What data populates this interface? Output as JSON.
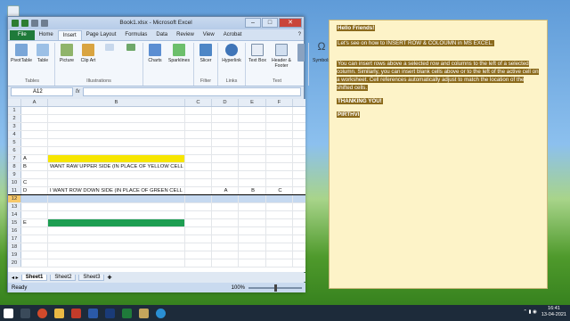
{
  "window": {
    "title": "Book1.xlsx - Microsoft Excel",
    "min": "–",
    "max": "□",
    "close": "✕"
  },
  "tabs": [
    "File",
    "Home",
    "Insert",
    "Page Layout",
    "Formulas",
    "Data",
    "Review",
    "View",
    "Acrobat"
  ],
  "ribbon": {
    "groups": [
      {
        "label": "Tables",
        "buttons": [
          "PivotTable",
          "Table"
        ]
      },
      {
        "label": "Illustrations",
        "buttons": [
          "Picture",
          "Clip Art",
          "",
          ""
        ]
      },
      {
        "label": "",
        "buttons": [
          "Charts",
          "Sparklines"
        ]
      },
      {
        "label": "Filter",
        "buttons": [
          "Slicer"
        ]
      },
      {
        "label": "Links",
        "buttons": [
          "Hyperlink"
        ]
      },
      {
        "label": "Text",
        "buttons": [
          "Text Box",
          "Header & Footer",
          ""
        ]
      },
      {
        "label": "",
        "buttons": [
          "Symbols"
        ]
      }
    ]
  },
  "formula_bar": {
    "name_box": "A12",
    "fx": "fx",
    "value": ""
  },
  "columns": [
    "",
    "A",
    "B",
    "C",
    "D",
    "E",
    "F"
  ],
  "rows": [
    {
      "n": "1",
      "A": "",
      "B": "",
      "D": "",
      "E": "",
      "F": ""
    },
    {
      "n": "2",
      "A": "",
      "B": "",
      "D": "",
      "E": "",
      "F": ""
    },
    {
      "n": "3",
      "A": "",
      "B": "",
      "D": "",
      "E": "",
      "F": ""
    },
    {
      "n": "4",
      "A": "",
      "B": "",
      "D": "",
      "E": "",
      "F": ""
    },
    {
      "n": "5",
      "A": "",
      "B": "",
      "D": "",
      "E": "",
      "F": ""
    },
    {
      "n": "6",
      "A": "",
      "B": "",
      "D": "",
      "E": "",
      "F": ""
    },
    {
      "n": "7",
      "A": "A",
      "B": "",
      "D": "",
      "E": "",
      "F": "",
      "fillB": "#f7e600"
    },
    {
      "n": "8",
      "A": "B",
      "B": "WANT RAW UPPER SIDE (IN PLACE OF YELLOW CELL",
      "D": "",
      "E": "",
      "F": ""
    },
    {
      "n": "9",
      "A": "",
      "B": "",
      "D": "",
      "E": "",
      "F": ""
    },
    {
      "n": "10",
      "A": "C",
      "B": "",
      "D": "",
      "E": "",
      "F": ""
    },
    {
      "n": "11",
      "A": "D",
      "B": "I WANT ROW DOWN SIDE (IN PLACE OF GREEN CELL",
      "D": "A",
      "E": "B",
      "F": "C"
    },
    {
      "n": "12",
      "A": "",
      "B": "",
      "D": "",
      "E": "",
      "F": "",
      "selected": true
    },
    {
      "n": "13",
      "A": "",
      "B": "",
      "D": "",
      "E": "",
      "F": ""
    },
    {
      "n": "14",
      "A": "",
      "B": "",
      "D": "",
      "E": "",
      "F": ""
    },
    {
      "n": "15",
      "A": "E",
      "B": "",
      "D": "",
      "E": "",
      "F": "",
      "fillB": "#1e9e52"
    },
    {
      "n": "16",
      "A": "",
      "B": "",
      "D": "",
      "E": "",
      "F": ""
    },
    {
      "n": "17",
      "A": "",
      "B": "",
      "D": "",
      "E": "",
      "F": ""
    },
    {
      "n": "18",
      "A": "",
      "B": "",
      "D": "",
      "E": "",
      "F": ""
    },
    {
      "n": "19",
      "A": "",
      "B": "",
      "D": "",
      "E": "",
      "F": ""
    },
    {
      "n": "20",
      "A": "",
      "B": "",
      "D": "",
      "E": "",
      "F": ""
    }
  ],
  "sheets": [
    "Sheet1",
    "Sheet2",
    "Sheet3"
  ],
  "status": {
    "left": "Ready",
    "zoom": "100%"
  },
  "note": {
    "p1": "Hello Friends!",
    "p2": "Let's see on how to INSERT ROW & COLOUMN in MS EXCEL.",
    "p3": "You can insert rows above a selected row and columns to the left of a selected column. Similarly, you can insert blank cells above or to the left of the active cell on a worksheet. Cell references automatically adjust to match the location of the shifted cells.",
    "p4": "THANKING YOU!",
    "p5": "PIRTHVI"
  },
  "clock": {
    "time": "16:41",
    "date": "13-04-2021"
  },
  "colors": {
    "excel_green": "#1f7a3a",
    "taskbar": "#1d2b3a",
    "note_bg": "#fdf3c8",
    "selected_row": "#c6d9f0"
  }
}
